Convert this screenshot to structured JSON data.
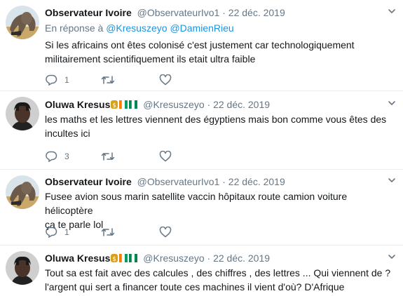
{
  "tweets": [
    {
      "name": "Observateur Ivoire",
      "handle": "@ObservateurIvo1",
      "sep": "·",
      "date": "22 déc. 2019",
      "reply_prefix": "En réponse à",
      "reply_users": [
        "@Kresuszeyo",
        "@DamienRieu"
      ],
      "text_lines": [
        "Si les africains ont êtes colonisé c'est justement car technologiquement",
        "militairement  scientifiquement ils etait ultra faible"
      ],
      "reply_count": "1",
      "retweet_count": "",
      "like_count": ""
    },
    {
      "name": "Oluwa Kresus",
      "handle": "@Kresuszeyo",
      "sep": "·",
      "date": "22 déc. 2019",
      "text_lines": [
        "les maths et les lettres viennent des égyptiens mais bon comme vous êtes des",
        "incultes ici"
      ],
      "reply_count": "3",
      "retweet_count": "",
      "like_count": ""
    },
    {
      "name": "Observateur Ivoire",
      "handle": "@ObservateurIvo1",
      "sep": "·",
      "date": "22 déc. 2019",
      "text_lines": [
        "Fusee avion sous marin satellite vaccin hôpitaux route camion voiture hélicoptère",
        "ça te parle lol"
      ],
      "reply_count": "1",
      "retweet_count": "",
      "like_count": ""
    },
    {
      "name": "Oluwa Kresus",
      "handle": "@Kresuszeyo",
      "sep": "·",
      "date": "22 déc. 2019",
      "text_lines": [
        "Tout sa est fait avec des calcules , des chiffres , des lettres ... Qui viennent de ?",
        "l'argent qui sert a financer toute ces machines il vient d'où? D'Afrique"
      ],
      "reply_count": "",
      "retweet_count": "",
      "like_count": ""
    }
  ],
  "icons": {
    "reply": "reply-icon",
    "retweet": "retweet-icon",
    "like": "heart-icon",
    "more": "chevron-down-icon",
    "name_emoji": "money-bag-emoji",
    "name_flags": "ivory-coast-flag-nigeria-flag"
  },
  "colors": {
    "link": "#1b95e0",
    "secondary_text": "#657786",
    "divider": "#e6ecf0"
  }
}
